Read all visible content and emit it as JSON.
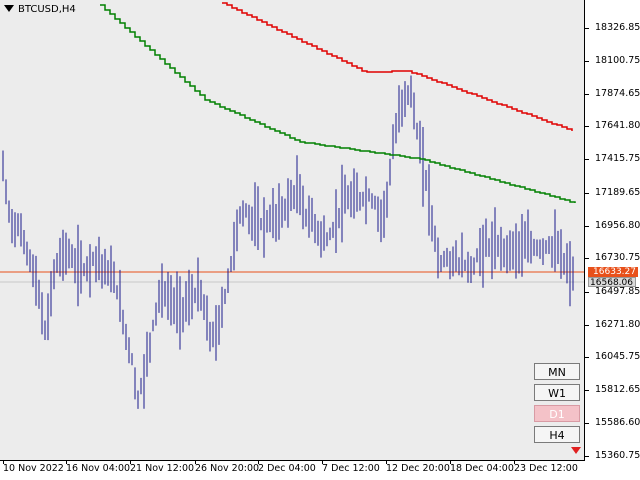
{
  "symbol": "BTCUSD,H4",
  "price_axis": {
    "labels": [
      "18326.85",
      "18100.75",
      "17874.65",
      "17641.80",
      "17415.75",
      "17189.65",
      "16956.80",
      "16730.75",
      "16497.85",
      "16271.80",
      "16045.75",
      "15812.65",
      "15586.60",
      "15360.75"
    ],
    "price_tags": {
      "current_red": "16633.27",
      "current_gray": "16568.06"
    }
  },
  "time_axis": {
    "labels": [
      "10 Nov 2022",
      "16 Nov 04:00",
      "21 Nov 12:00",
      "26 Nov 20:00",
      "2 Dec 04:00",
      "7 Dec 12:00",
      "12 Dec 20:00",
      "18 Dec 04:00",
      "23 Dec 12:00"
    ]
  },
  "timeframe_buttons": [
    {
      "label": "MN",
      "active": false
    },
    {
      "label": "W1",
      "active": false
    },
    {
      "label": "D1",
      "active": true
    },
    {
      "label": "H4",
      "active": false
    }
  ],
  "colors": {
    "bars": "#1a1a8c",
    "upper_line": "#e00000",
    "middle_line": "#008000",
    "price_line": "#e8501a",
    "background": "#ececec"
  },
  "icons": {
    "menu": "triangle-down-icon",
    "scroll": "red-arrow-down-icon"
  }
}
